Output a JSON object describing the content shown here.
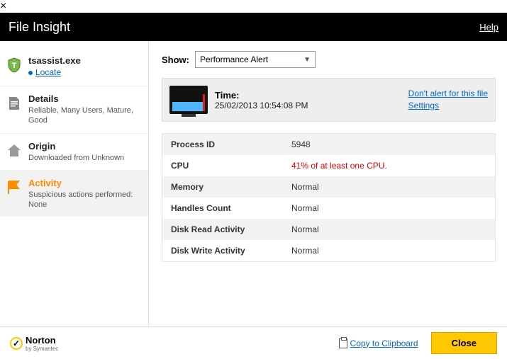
{
  "header": {
    "title": "File Insight",
    "help": "Help"
  },
  "sidebar": {
    "file": {
      "name": "tsassist.exe",
      "locate": "Locate"
    },
    "details": {
      "title": "Details",
      "sub": "Reliable,  Many Users,  Mature,  Good"
    },
    "origin": {
      "title": "Origin",
      "sub": "Downloaded from Unknown"
    },
    "activity": {
      "title": "Activity",
      "sub": "Suspicious actions performed:  None"
    }
  },
  "content": {
    "showLabel": "Show:",
    "showValue": "Performance Alert",
    "timeLabel": "Time:",
    "timeValue": "25/02/2013 10:54:08 PM",
    "linkDontAlert": "Don't alert for this file",
    "linkSettings": "Settings",
    "rows": {
      "pid_k": "Process ID",
      "pid_v": "5948",
      "cpu_k": "CPU",
      "cpu_v": "41% of at least one CPU.",
      "mem_k": "Memory",
      "mem_v": "Normal",
      "hnd_k": "Handles Count",
      "hnd_v": "Normal",
      "drd_k": "Disk Read Activity",
      "drd_v": "Normal",
      "dwr_k": "Disk Write Activity",
      "dwr_v": "Normal"
    }
  },
  "footer": {
    "brand": "Norton",
    "by": "by Symantec",
    "copy": "Copy to Clipboard",
    "close": "Close"
  }
}
